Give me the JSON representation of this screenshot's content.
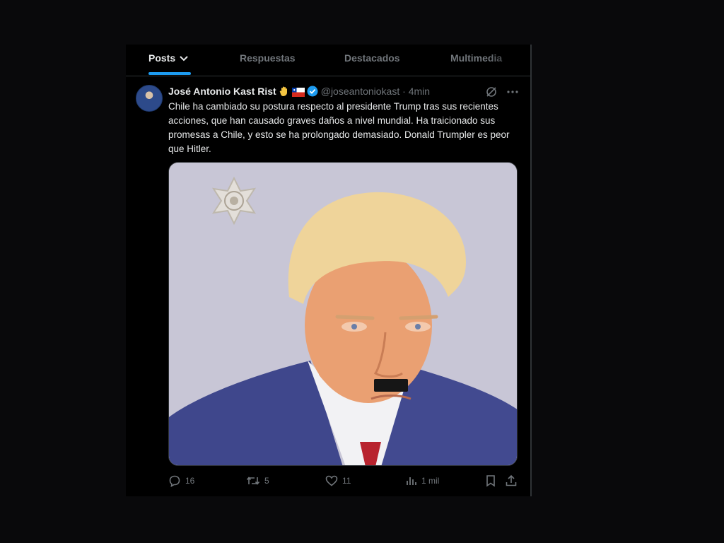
{
  "tabs": [
    {
      "label": "Posts",
      "active": true
    },
    {
      "label": "Respuestas",
      "active": false
    },
    {
      "label": "Destacados",
      "active": false
    },
    {
      "label": "Multimedia",
      "active": false
    }
  ],
  "tweet": {
    "author": "José Antonio Kast Rist",
    "emoji": [
      "raised-hand-emoji",
      "chile-flag-emoji"
    ],
    "handle": "@joseantoniokast",
    "separator": "·",
    "time": "4min",
    "text": "Chile ha cambiado su postura respecto al presidente Trump tras sus recientes acciones, que han causado graves daños a nivel mundial. Ha traicionado sus promesas a Chile, y esto se ha prolongado demasiado. Donald Trumpler es peor que Hitler."
  },
  "stats": {
    "replies": "16",
    "reposts": "5",
    "likes": "11",
    "views": "1 mil"
  },
  "colors": {
    "accent": "#1d9bf0",
    "muted": "#71767b",
    "text": "#e7e9ea",
    "background": "#000000"
  }
}
